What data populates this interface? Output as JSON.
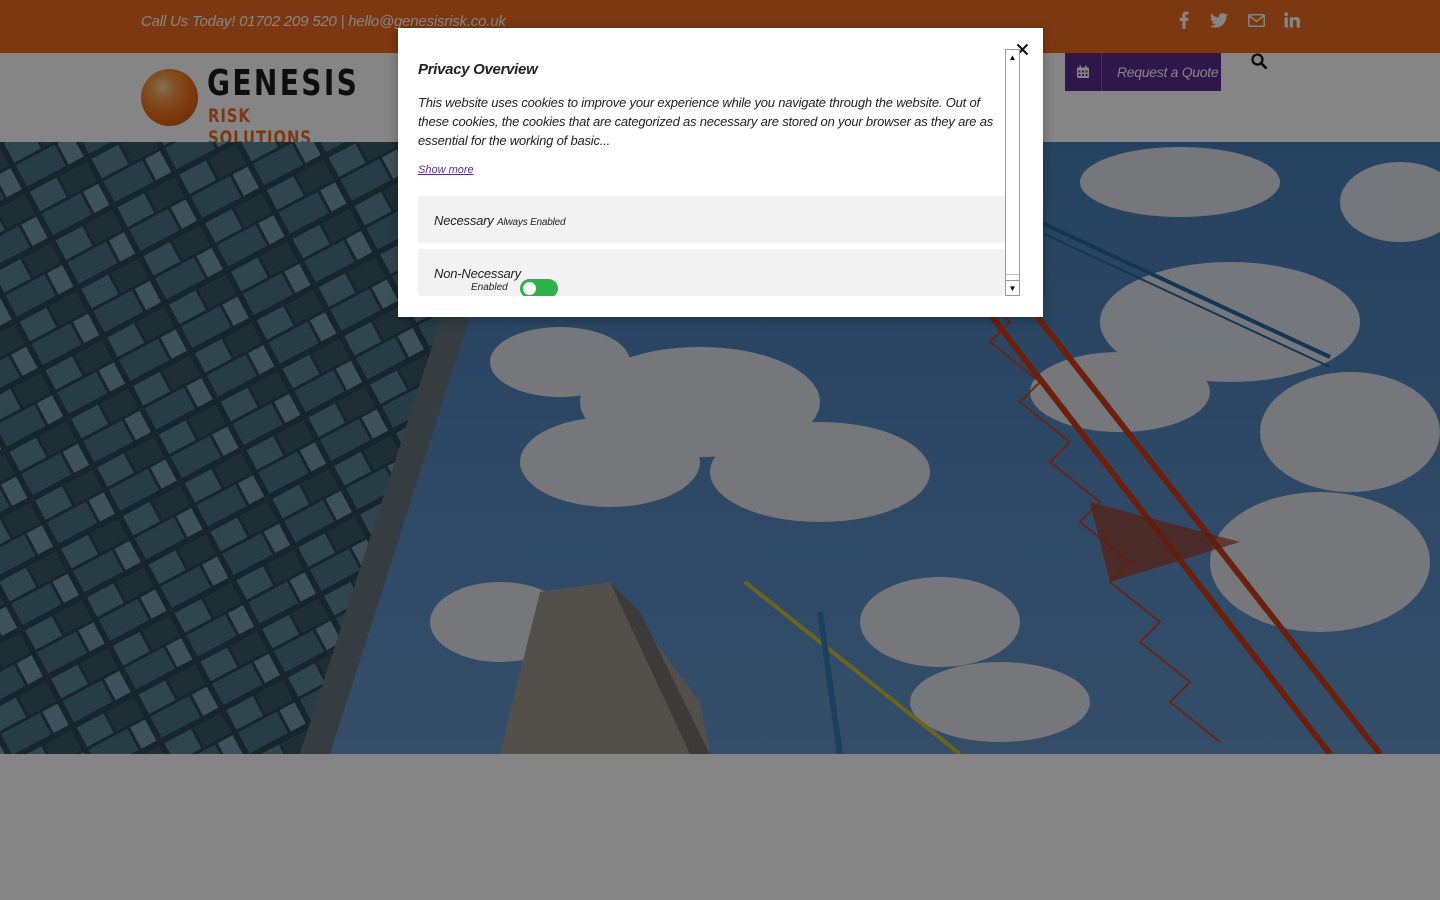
{
  "topbar": {
    "contact": "Call Us Today! 01702 209 520 | hello@genesisrisk.co.uk",
    "social": [
      "facebook-icon",
      "twitter-icon",
      "envelope-icon",
      "linkedin-icon"
    ]
  },
  "header": {
    "logo_word": "GENESIS",
    "logo_sub": "RISK SOLUTIONS",
    "quote_label": "Request a Quote"
  },
  "colors": {
    "brand_orange": "#ee6b22",
    "brand_purple": "#5b2d8f",
    "toggle_green": "#2cb34a"
  },
  "modal": {
    "title": "Privacy Overview",
    "description": "This website uses cookies to improve your experience while you navigate through the website. Out of these cookies, the cookies that are categorized as necessary are stored on your browser as they are as essential for the working of basic...",
    "show_more": "Show more",
    "categories": [
      {
        "name": "Necessary",
        "state": "Always Enabled"
      },
      {
        "name": "Non-Necessary",
        "state": "Enabled",
        "toggle_on": true
      }
    ]
  }
}
